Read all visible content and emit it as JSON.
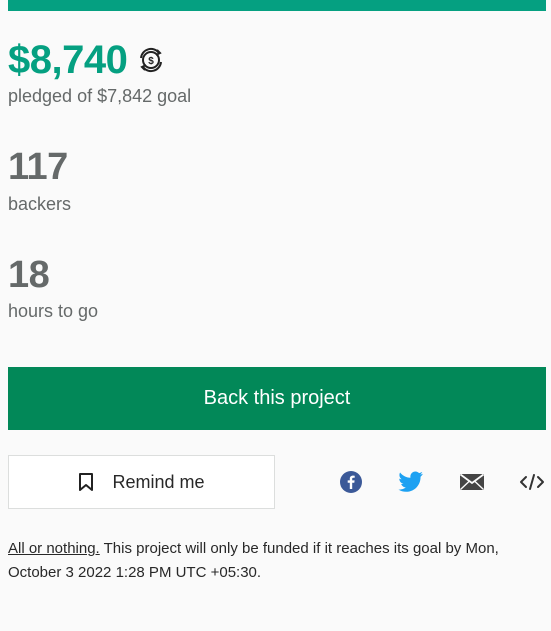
{
  "campaign": {
    "progress_fraction": 1.0,
    "pledged_amount": "$8,740",
    "pledged_goal_text": "pledged of $7,842 goal",
    "backers_count": "117",
    "backers_label": "backers",
    "time_left_value": "18",
    "time_left_label": "hours to go"
  },
  "actions": {
    "back_project_label": "Back this project",
    "remind_me_label": "Remind me"
  },
  "share": {
    "icons": [
      "facebook-icon",
      "twitter-icon",
      "email-icon",
      "embed-icon"
    ]
  },
  "footnote": {
    "link_text": "All or nothing.",
    "text": " This project will only be funded if it reaches its goal by Mon, October 3 2022 1:28 PM UTC +05:30."
  },
  "colors": {
    "accent_green": "#05a081",
    "button_green": "#028858",
    "facebook_blue": "#3b5998",
    "twitter_blue": "#1da1f2",
    "muted_text": "#656969"
  }
}
